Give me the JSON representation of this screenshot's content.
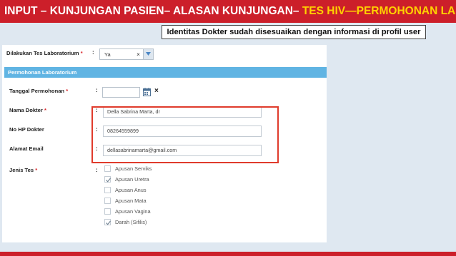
{
  "header": {
    "title_prefix": "INPUT – KUNJUNGAN PASIEN– ALASAN KUNJUNGAN– ",
    "title_highlight": "TES HIV—PERMOHONAN LAB"
  },
  "note": "Identitas Dokter sudah disesuaikan dengan informasi di profil user",
  "form": {
    "lab_test": {
      "label": "Dilakukan Tes Laboratorium",
      "value": "Ya",
      "clear": "×"
    },
    "section_title": "Permohonan Laboratorium",
    "request_date": {
      "label": "Tanggal Permohonan",
      "value": "",
      "clear": "×"
    },
    "doctor_name": {
      "label": "Nama Dokter",
      "value": "Della Sabrina Marta, dr"
    },
    "doctor_phone": {
      "label": "No HP Dokter",
      "value": "08264559899"
    },
    "email": {
      "label": "Alamat Email",
      "value": "dellasabrinamarta@gmail.com"
    },
    "test_types": {
      "label": "Jenis Tes",
      "options": [
        {
          "label": "Apusan Serviks",
          "checked": false
        },
        {
          "label": "Apusan Uretra",
          "checked": true
        },
        {
          "label": "Apusan Anus",
          "checked": false
        },
        {
          "label": "Apusan Mata",
          "checked": false
        },
        {
          "label": "Apusan Vagina",
          "checked": false
        },
        {
          "label": "Darah (Sifilis)",
          "checked": true
        }
      ]
    }
  },
  "colors": {
    "banner": "#cc1f2a",
    "highlight_text": "#ffd200",
    "section_header": "#60b4e3",
    "focus_box": "#e03b2c"
  }
}
